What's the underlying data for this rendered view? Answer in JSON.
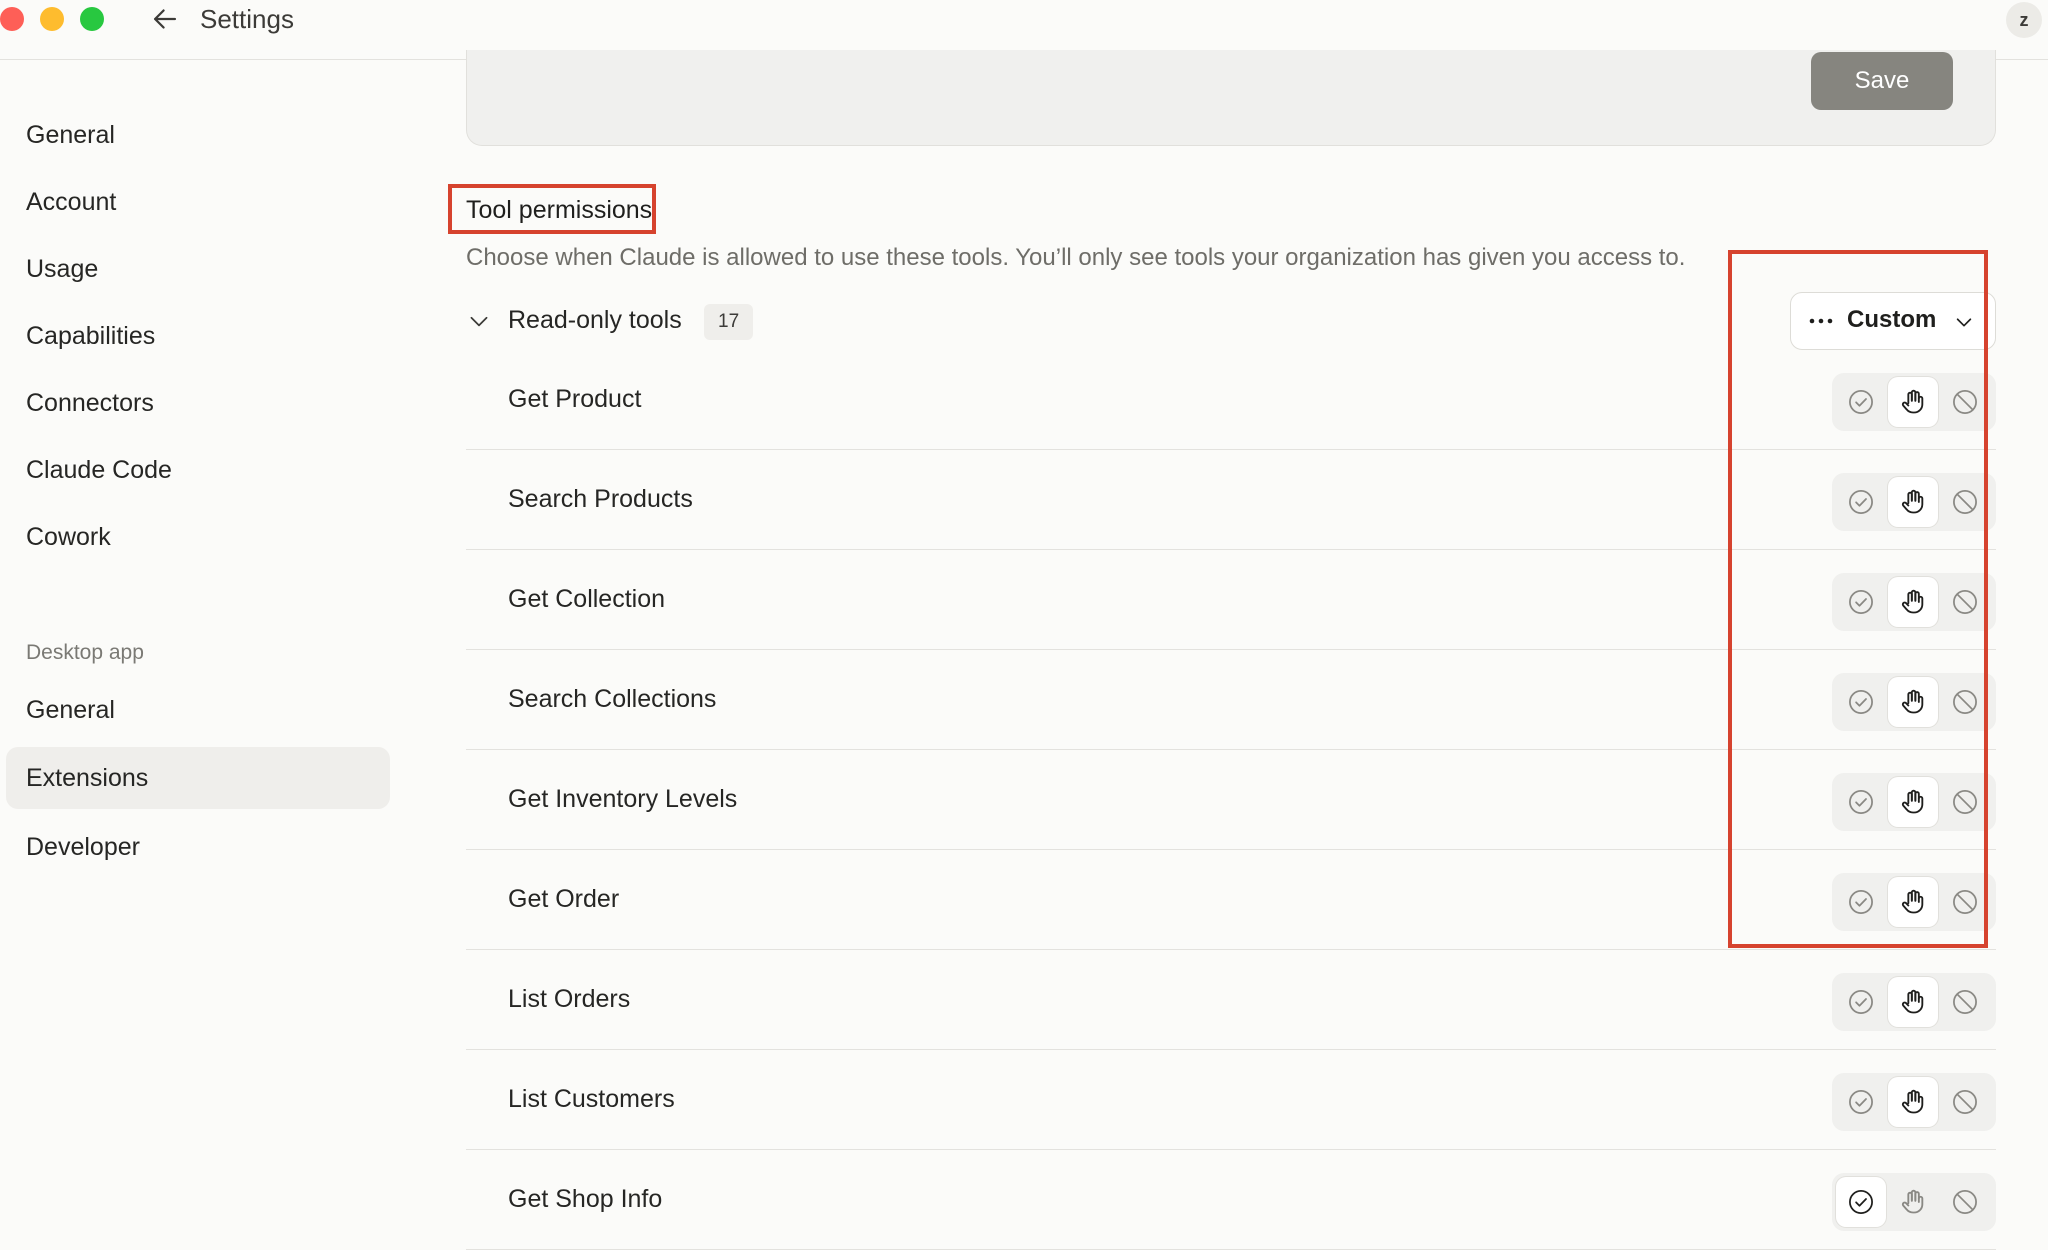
{
  "titlebar": {
    "title": "Settings",
    "avatar_initial": "z"
  },
  "sidebar": {
    "items": [
      {
        "label": "General"
      },
      {
        "label": "Account"
      },
      {
        "label": "Usage"
      },
      {
        "label": "Capabilities"
      },
      {
        "label": "Connectors"
      },
      {
        "label": "Claude Code"
      },
      {
        "label": "Cowork"
      }
    ],
    "desktop_section_label": "Desktop app",
    "desktop_items": [
      {
        "label": "General"
      },
      {
        "label": "Extensions",
        "active": true
      },
      {
        "label": "Developer"
      }
    ]
  },
  "main": {
    "save_label": "Save",
    "tool_permissions": {
      "title": "Tool permissions",
      "description": "Choose when Claude is allowed to use these tools. You’ll only see tools your organization has given you access to.",
      "group": {
        "label": "Read-only tools",
        "count": "17",
        "mode": "Custom"
      },
      "tools": [
        {
          "name": "Get Product",
          "selected": "ask"
        },
        {
          "name": "Search Products",
          "selected": "ask"
        },
        {
          "name": "Get Collection",
          "selected": "ask"
        },
        {
          "name": "Search Collections",
          "selected": "ask"
        },
        {
          "name": "Get Inventory Levels",
          "selected": "ask"
        },
        {
          "name": "Get Order",
          "selected": "ask"
        },
        {
          "name": "List Orders",
          "selected": "ask"
        },
        {
          "name": "List Customers",
          "selected": "ask"
        },
        {
          "name": "Get Shop Info",
          "selected": "allow"
        }
      ]
    }
  },
  "colors": {
    "highlight": "#d6432e",
    "save_button": "#86857f",
    "active_nav": "#efeeeb"
  },
  "icons": [
    "back-arrow-icon",
    "dots-icon",
    "chevron-down-icon",
    "check-circle-icon",
    "hand-icon",
    "block-icon"
  ]
}
